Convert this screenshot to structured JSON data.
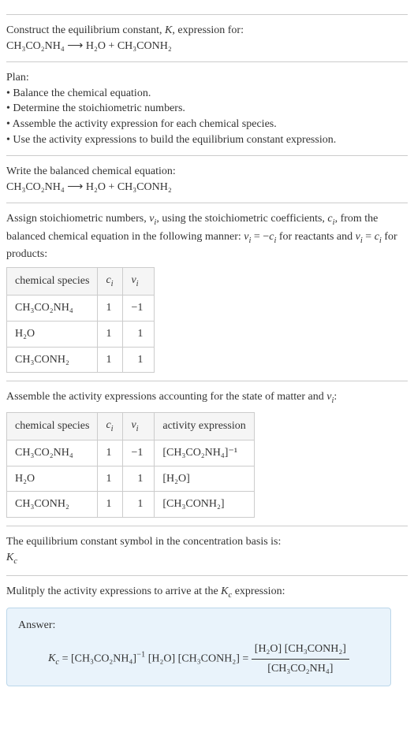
{
  "intro": {
    "prompt_line1": "Construct the equilibrium constant, K, expression for:",
    "equation": "CH₃CO₂NH₄ ⟶ H₂O + CH₃CONH₂"
  },
  "plan": {
    "heading": "Plan:",
    "items": [
      "• Balance the chemical equation.",
      "• Determine the stoichiometric numbers.",
      "• Assemble the activity expression for each chemical species.",
      "• Use the activity expressions to build the equilibrium constant expression."
    ]
  },
  "balanced": {
    "heading": "Write the balanced chemical equation:",
    "equation": "CH₃CO₂NH₄ ⟶ H₂O + CH₃CONH₂"
  },
  "stoich": {
    "intro": "Assign stoichiometric numbers, νᵢ, using the stoichiometric coefficients, cᵢ, from the balanced chemical equation in the following manner: νᵢ = −cᵢ for reactants and νᵢ = cᵢ for products:",
    "headers": [
      "chemical species",
      "cᵢ",
      "νᵢ"
    ],
    "rows": [
      {
        "species": "CH₃CO₂NH₄",
        "c": "1",
        "v": "−1"
      },
      {
        "species": "H₂O",
        "c": "1",
        "v": "1"
      },
      {
        "species": "CH₃CONH₂",
        "c": "1",
        "v": "1"
      }
    ]
  },
  "activity": {
    "intro": "Assemble the activity expressions accounting for the state of matter and νᵢ:",
    "headers": [
      "chemical species",
      "cᵢ",
      "νᵢ",
      "activity expression"
    ],
    "rows": [
      {
        "species": "CH₃CO₂NH₄",
        "c": "1",
        "v": "−1",
        "expr": "[CH₃CO₂NH₄]⁻¹"
      },
      {
        "species": "H₂O",
        "c": "1",
        "v": "1",
        "expr": "[H₂O]"
      },
      {
        "species": "CH₃CONH₂",
        "c": "1",
        "v": "1",
        "expr": "[CH₃CONH₂]"
      }
    ]
  },
  "symbol": {
    "line1": "The equilibrium constant symbol in the concentration basis is:",
    "line2": "K_c"
  },
  "multiply": {
    "intro": "Mulitply the activity expressions to arrive at the K_c expression:"
  },
  "answer": {
    "label": "Answer:",
    "lhs": "K_c = [CH₃CO₂NH₄]⁻¹ [H₂O] [CH₃CONH₂] =",
    "frac_num": "[H₂O] [CH₃CONH₂]",
    "frac_den": "[CH₃CO₂NH₄]"
  }
}
